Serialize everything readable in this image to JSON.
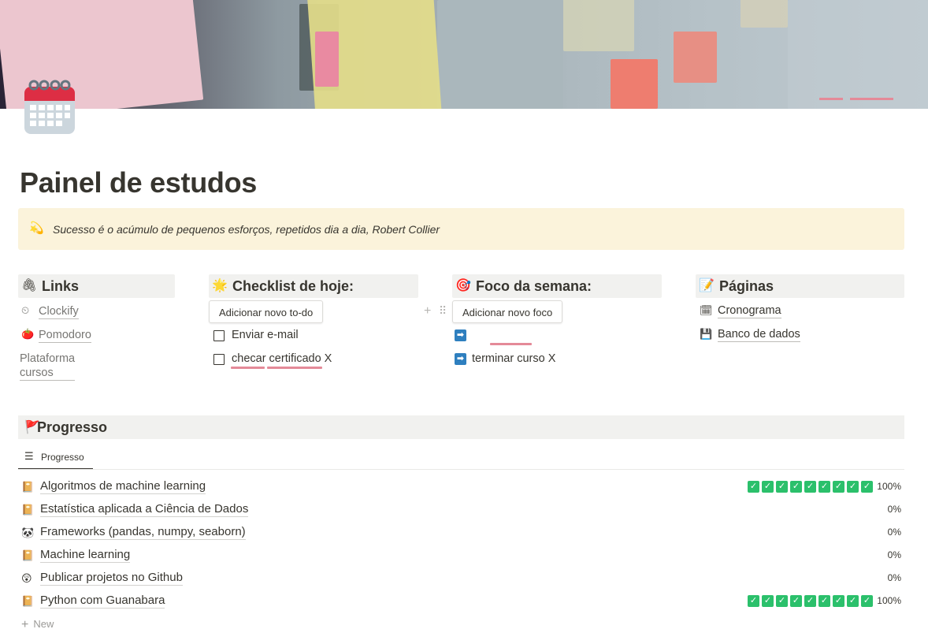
{
  "page": {
    "title": "Painel de estudos",
    "icon": "calendar-icon",
    "callout": {
      "icon": "star-icon",
      "text": "Sucesso é o acúmulo de pequenos esforços, repetidos dia a dia, Robert Collier"
    }
  },
  "columns": {
    "links": {
      "header": "Links",
      "icon": "paperclip-icon",
      "items": [
        {
          "icon": "clock-icon",
          "label": "Clockify"
        },
        {
          "icon": "tomato-icon",
          "label": "Pomodoro"
        },
        {
          "icon": "",
          "label": "Plataforma cursos"
        }
      ]
    },
    "checklist": {
      "header": "Checklist de hoje:",
      "icon": "star-icon",
      "button": "Adicionar novo to-do",
      "items": [
        {
          "label": "Enviar e-mail",
          "checked": false
        },
        {
          "label": "checar certificado X",
          "checked": false
        }
      ]
    },
    "foco": {
      "header": "Foco da semana:",
      "icon": "target-icon",
      "button": "Adicionar novo foco",
      "items": [
        {
          "icon": "right-arrow-icon",
          "label": ""
        },
        {
          "icon": "right-arrow-icon",
          "label": "terminar curso X"
        }
      ]
    },
    "paginas": {
      "header": "Páginas",
      "icon": "memo-icon",
      "items": [
        {
          "icon": "calendar-icon",
          "label": "Cronograma"
        },
        {
          "icon": "floppy-icon",
          "label": "Banco de dados"
        }
      ]
    }
  },
  "progress": {
    "header": "Progresso",
    "icon": "flag-icon",
    "view_tab": "Progresso",
    "rows": [
      {
        "icon": "book-icon",
        "title": "Algoritmos de machine learning",
        "percent": "100%",
        "checks": 9
      },
      {
        "icon": "book-icon",
        "title": "Estatística aplicada a Ciência de Dados",
        "percent": "0%",
        "checks": 0
      },
      {
        "icon": "panda-icon",
        "title": "Frameworks (pandas, numpy, seaborn)",
        "percent": "0%",
        "checks": 0
      },
      {
        "icon": "book-icon",
        "title": "Machine learning",
        "percent": "0%",
        "checks": 0
      },
      {
        "icon": "astonished-face-icon",
        "title": "Publicar projetos no Github",
        "percent": "0%",
        "checks": 0
      },
      {
        "icon": "book-icon",
        "title": "Python com Guanabara",
        "percent": "100%",
        "checks": 9
      }
    ],
    "new_label": "New"
  },
  "colors": {
    "callout_bg": "#fbf3db",
    "header_bg": "#f1f1ef",
    "check_green": "#2bc06b",
    "arrow_blue": "#2e7fbf",
    "underline_pink": "#e48a98"
  }
}
